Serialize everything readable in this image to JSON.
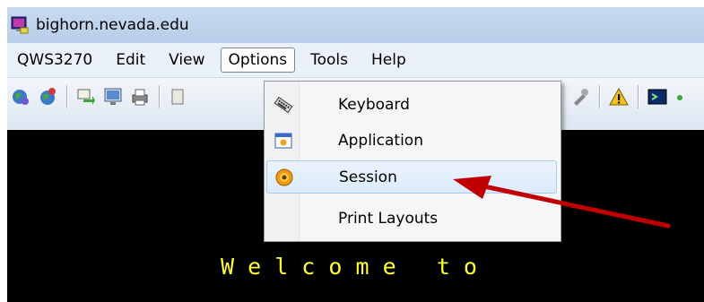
{
  "window": {
    "title": "bighorn.nevada.edu"
  },
  "menubar": {
    "items": [
      {
        "label": "QWS3270"
      },
      {
        "label": "Edit"
      },
      {
        "label": "View"
      },
      {
        "label": "Options",
        "open": true
      },
      {
        "label": "Tools"
      },
      {
        "label": "Help"
      }
    ]
  },
  "toolbar": {
    "icons": [
      "connect-globe-icon",
      "disconnect-globe-icon",
      "transfer-icon",
      "screen-icon",
      "print-icon",
      "settings-icon",
      "warning-icon",
      "terminal-icon"
    ]
  },
  "options_menu": {
    "items": [
      {
        "label": "Keyboard",
        "icon": "keyboard-icon"
      },
      {
        "label": "Application",
        "icon": "application-icon"
      },
      {
        "label": "Session",
        "icon": "session-gear-icon",
        "highlighted": true
      },
      {
        "label": "Print Layouts",
        "icon": ""
      }
    ]
  },
  "terminal": {
    "text": "W e l c o m e   t o"
  },
  "colors": {
    "terminal_bg": "#000000",
    "terminal_text": "#ffff33",
    "annotation_arrow": "#c00000"
  }
}
